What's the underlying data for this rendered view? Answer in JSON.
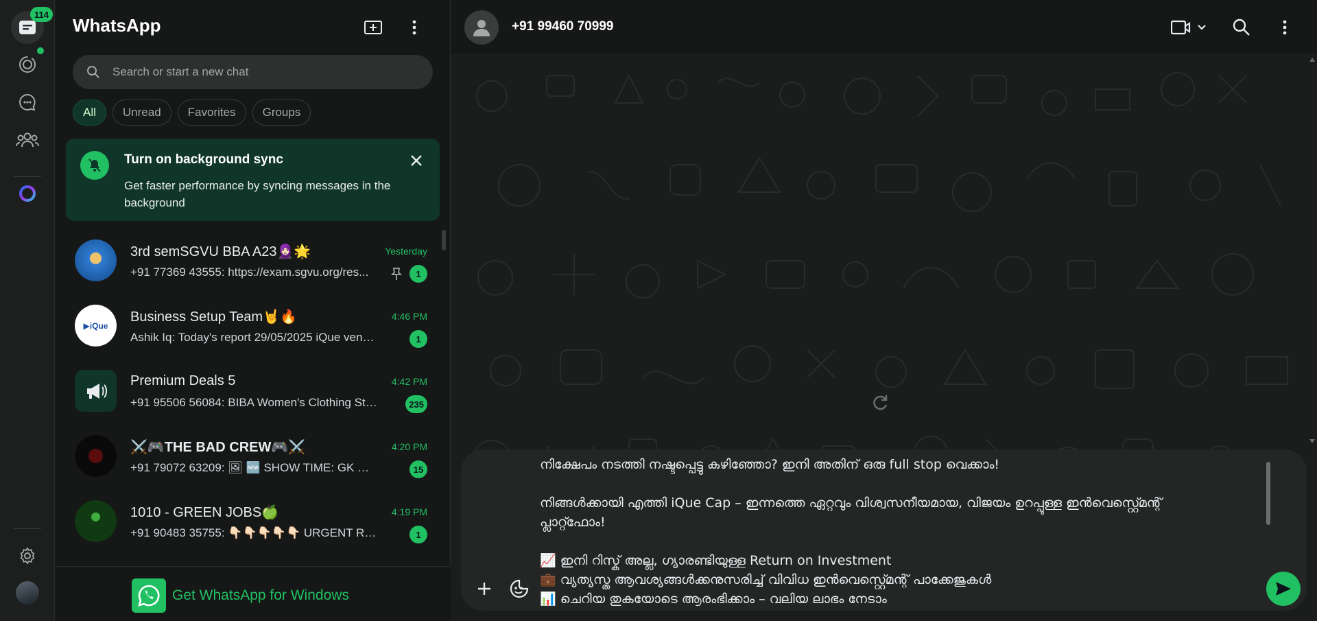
{
  "rail": {
    "badge": "114",
    "items": [
      "chats-icon",
      "status-icon",
      "channels-icon",
      "communities-icon",
      "meta-ai-icon",
      "settings-icon",
      "profile-avatar"
    ]
  },
  "list": {
    "title": "WhatsApp",
    "search_placeholder": "Search or start a new chat",
    "filters": [
      "All",
      "Unread",
      "Favorites",
      "Groups"
    ],
    "sync_banner": {
      "title": "Turn on background sync",
      "body": "Get faster performance by syncing messages in the background"
    },
    "chats": [
      {
        "name": "3rd semSGVU BBA A23🧕🏻🌟",
        "time": "Yesterday",
        "preview": "+91 77369 43555: https://exam.sgvu.org/res...",
        "unread": "1",
        "pinned": true,
        "avatar_color": "#1c5fa8"
      },
      {
        "name": "Business Setup Team🤘🔥",
        "time": "4:46 PM",
        "preview": "Ashik Iq: Today's report 29/05/2025 iQue ventur...",
        "unread": "1",
        "pinned": false,
        "avatar_color": "#ffffff"
      },
      {
        "name": "Premium Deals 5",
        "time": "4:42 PM",
        "preview": "+91 95506 56084: BIBA Women's Clothing Star...",
        "unread": "235",
        "pinned": false,
        "avatar_color": "#103529"
      },
      {
        "name": "⚔️🎮THE BAD CREW🎮⚔️",
        "time": "4:20 PM",
        "preview": "+91 79072 63209: 🖼 🆕 SHOW TIME: GK DIRE...",
        "unread": "15",
        "pinned": false,
        "avatar_color": "#0a0a0a"
      },
      {
        "name": "1010 - GREEN JOBS🍏",
        "time": "4:19 PM",
        "preview": "+91 90483 35755: 👇🏻👇🏻👇🏻👇🏻👇🏻 URGENT REQ...",
        "unread": "1",
        "pinned": false,
        "avatar_color": "#0f3a12"
      }
    ],
    "get_windows": "Get WhatsApp for Windows"
  },
  "conversation": {
    "contact": "+91 99460 70999",
    "composer_lines": [
      "നിക്ഷേപം നടത്തി നഷ്ടപ്പെട്ടു കഴിഞ്ഞോ? ഇനി അതിന് ഒരു full stop വെക്കാം!",
      "",
      "നിങ്ങൾക്കായി എത്തി iQue Cap – ഇന്നത്തെ ഏറ്റവും വിശ്വസനീയമായ, വിജയം ഉറപ്പുള്ള ഇൻവെസ്റ്റ്മെന്റ്",
      "പ്ലാറ്റ്ഫോം!",
      "",
      "📈 ഇനി റിസ്ക് അല്ല, ഗ്യാരണ്ടിയുള്ള Return on Investment",
      "💼 വ്യത്യസ്ത ആവശ്യങ്ങൾക്കനുസരിച്ച് വിവിധ ഇൻവെസ്റ്റ്മെന്റ് പാക്കേജുകൾ",
      "📊 ചെറിയ തുകയോടെ ആരംഭിക്കാം – വലിയ ലാഭം നേടാം"
    ]
  },
  "colors": {
    "accent": "#21c063",
    "banner_bg": "#103529",
    "panel_bg": "#161717"
  }
}
